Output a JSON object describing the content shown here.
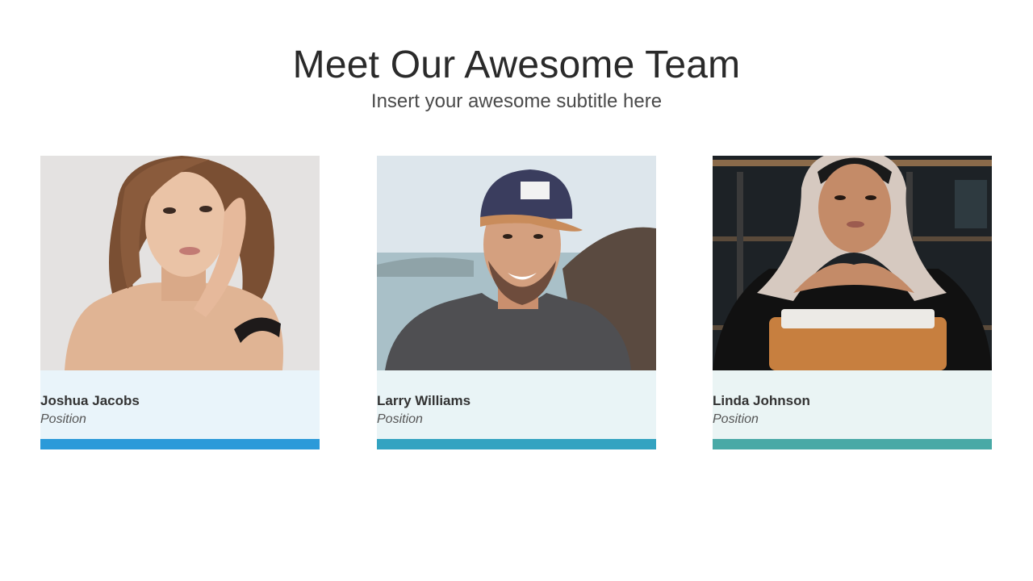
{
  "header": {
    "title": "Meet Our Awesome Team",
    "subtitle": "Insert your awesome subtitle here"
  },
  "members": [
    {
      "name": "Joshua Jacobs",
      "position": "Position",
      "accent_color": "#2b9ad9",
      "info_bg": "#e9f4fa"
    },
    {
      "name": "Larry Williams",
      "position": "Position",
      "accent_color": "#33a3c1",
      "info_bg": "#e9f4f6"
    },
    {
      "name": "Linda Johnson",
      "position": "Position",
      "accent_color": "#49a9a6",
      "info_bg": "#eaf4f4"
    }
  ],
  "colors": {
    "background": "#ffffff",
    "title_text": "#2a2a2a"
  }
}
